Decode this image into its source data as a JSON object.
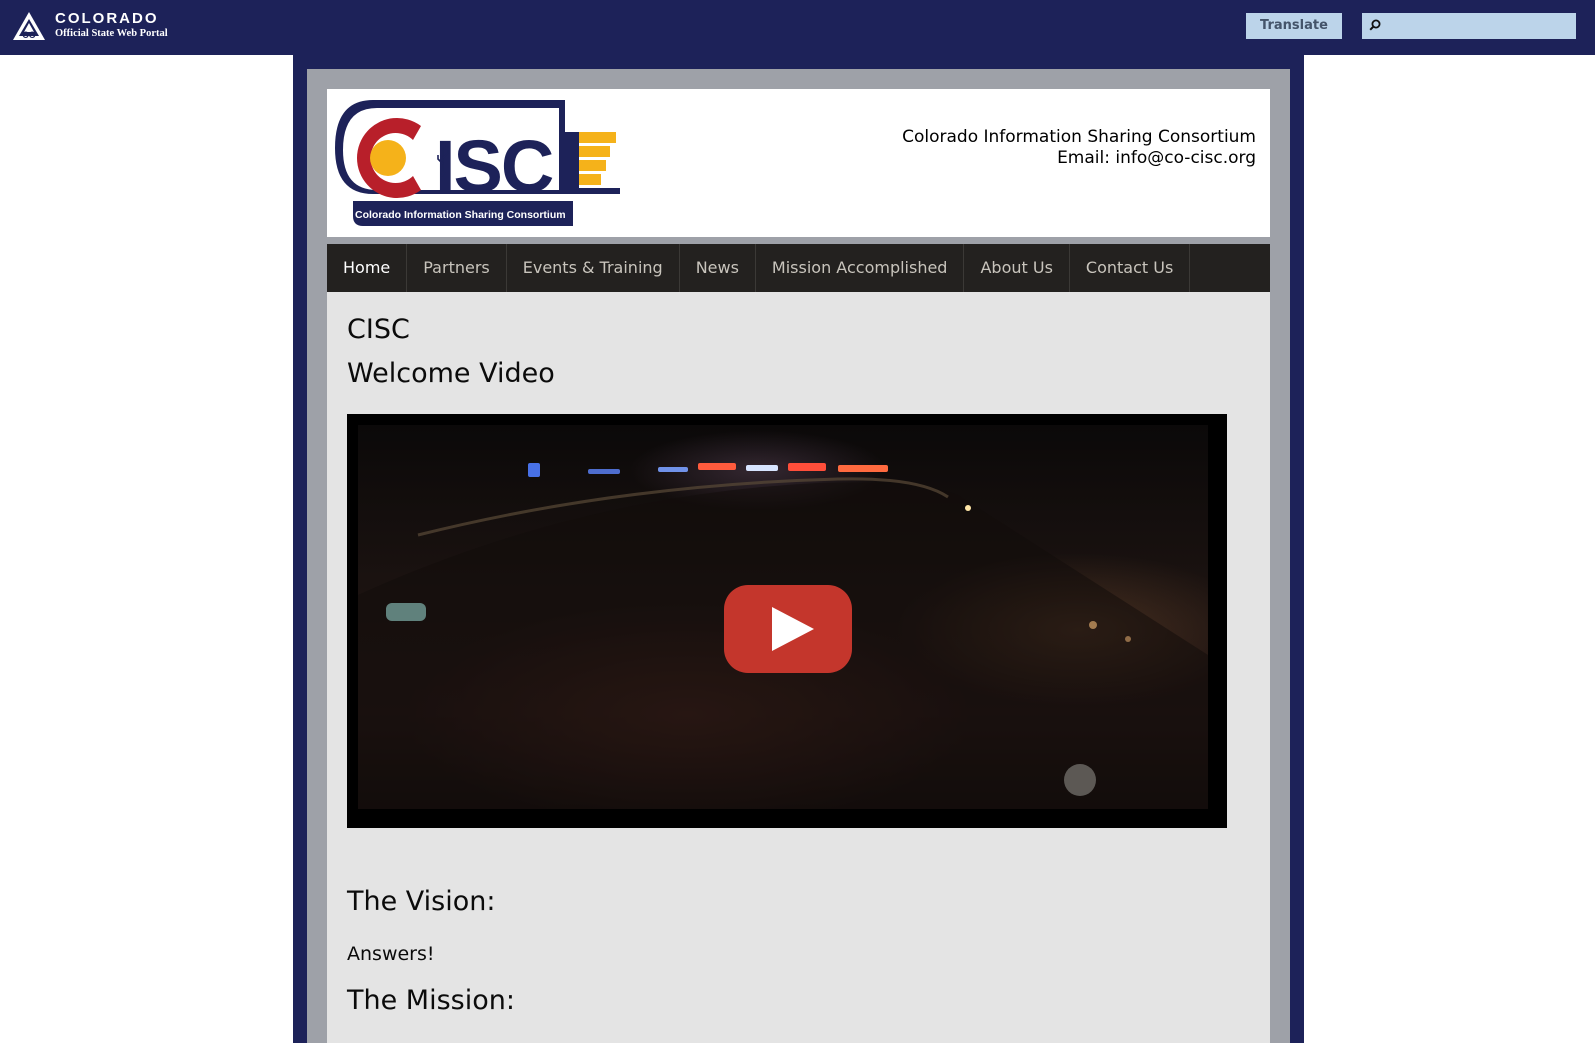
{
  "portal": {
    "name": "COLORADO",
    "subtitle": "Official State Web Portal",
    "logo_icon": "colorado-mountain-logo",
    "translate_label": "Translate",
    "search": {
      "value": "",
      "icon": "search-icon"
    },
    "colors": {
      "bar": "#1d2259",
      "translate_bg": "#bcd4ea",
      "translate_text": "#44546a"
    }
  },
  "header": {
    "logo_text": "CISC",
    "logo_tagline": "Colorado Information Sharing Consortium",
    "org_name": "Colorado Information Sharing Consortium",
    "email_line": "Email: info@co-cisc.org"
  },
  "nav": {
    "items": [
      {
        "label": "Home",
        "active": true
      },
      {
        "label": "Partners",
        "active": false
      },
      {
        "label": "Events & Training",
        "active": false
      },
      {
        "label": "News",
        "active": false
      },
      {
        "label": "Mission Accomplished",
        "active": false
      },
      {
        "label": "About Us",
        "active": false
      },
      {
        "label": "Contact Us",
        "active": false
      }
    ]
  },
  "content": {
    "title": "CISC",
    "subtitle": "Welcome Video",
    "video": {
      "play_icon": "youtube-play-icon"
    },
    "vision_heading": "The Vision:",
    "vision_text": "Answers!",
    "mission_heading": "The Mission:"
  },
  "colors": {
    "brand_navy": "#1d2259",
    "brand_red": "#b81f2a",
    "brand_gold": "#f5b21a",
    "nav_bg": "#23211f",
    "content_bg": "#e4e4e4",
    "youtube_red": "#c4362c"
  }
}
